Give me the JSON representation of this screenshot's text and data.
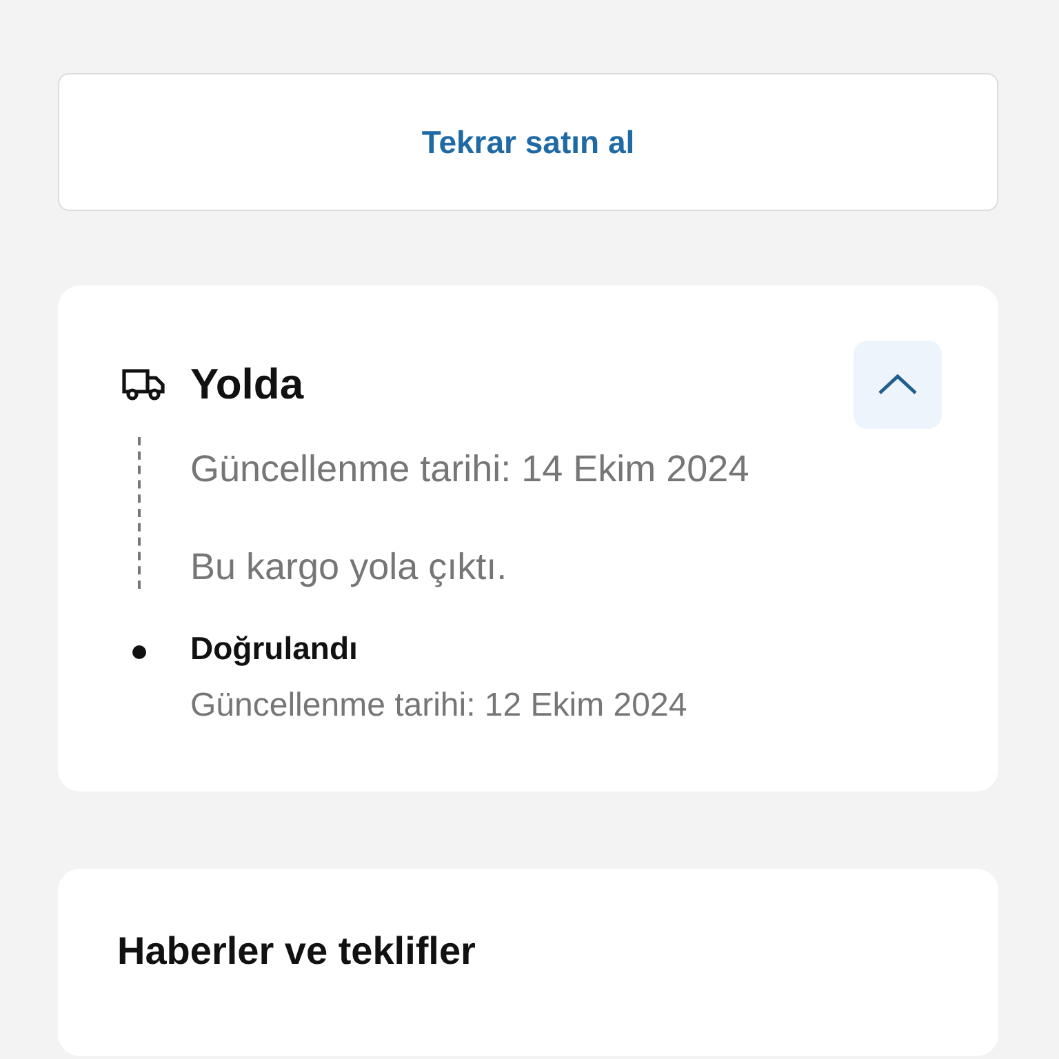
{
  "reorder_button": {
    "label": "Tekrar satın al"
  },
  "shipment": {
    "status": "Yolda",
    "expanded": true,
    "current": [
      {
        "text": "Güncellenme tarihi: 14 Ekim 2024"
      },
      {
        "text": "Bu kargo yola çıktı."
      }
    ],
    "steps": [
      {
        "title": "Doğrulandı",
        "date": "Güncellenme tarihi: 12 Ekim 2024"
      }
    ]
  },
  "news": {
    "title": "Haberler ve teklifler"
  }
}
